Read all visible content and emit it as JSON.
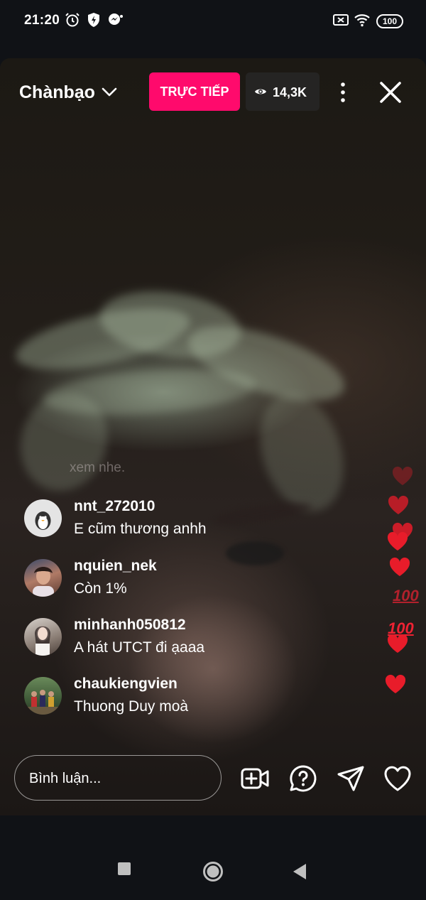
{
  "status_bar": {
    "time": "21:20",
    "battery": "100",
    "icons": [
      "alarm-icon",
      "shield-bolt-icon",
      "messenger-icon",
      "no-sim-icon",
      "wifi-icon",
      "battery-icon"
    ]
  },
  "live": {
    "channel_name": "Chànbạo",
    "live_label": "TRỰC TIẾP",
    "viewer_count": "14,3K",
    "live_color": "#ff0a6c"
  },
  "comments": {
    "faded": "xem nhe.",
    "items": [
      {
        "username": "nnt_272010",
        "text": "E cũm thương anhh"
      },
      {
        "username": "nquien_nek",
        "text": "Còn 1%"
      },
      {
        "username": "minhanh050812",
        "text": "A hát UTCT đi ạaaa"
      },
      {
        "username": "chaukiengvien",
        "text": "Thuong Duy moà"
      }
    ]
  },
  "reactions": {
    "hundred_emoji": "100",
    "heart_color": "#e81c2a"
  },
  "bottom_bar": {
    "comment_placeholder": "Bình luận...",
    "icons": [
      "add-video-icon",
      "question-icon",
      "send-icon",
      "heart-icon"
    ]
  },
  "nav": {
    "icons": [
      "recents-icon",
      "home-icon",
      "back-icon"
    ]
  }
}
